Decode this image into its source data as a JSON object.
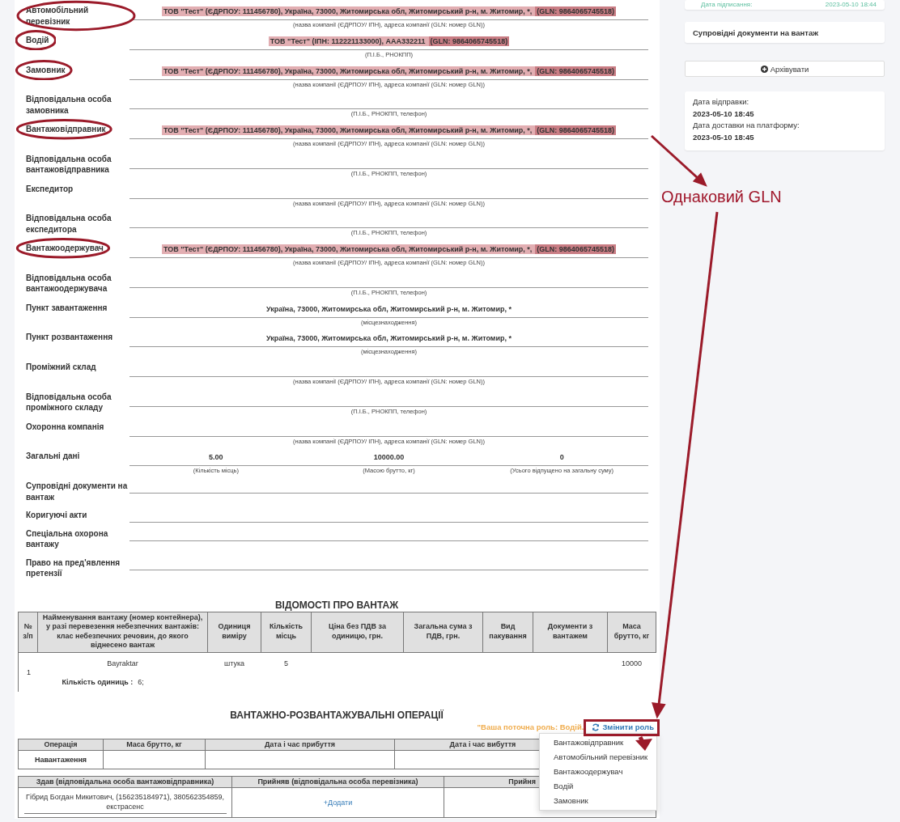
{
  "form": {
    "rows": [
      {
        "kind": "field",
        "label": "Автомобільний перевізник",
        "circled": true,
        "value": "ТОВ \"Тест\" (ЄДРПОУ: 111456780), Україна, 73000, Житомирська обл, Житомирський р-н, м. Житомир, *,",
        "gln": "(GLN: 9864065745518)",
        "highlighted": true,
        "hint": "(назва компанії (ЄДРПОУ/ ІПН), адреса компанії (GLN: номер GLN))"
      },
      {
        "kind": "field",
        "label": "Водій",
        "circled": true,
        "value": "ТОВ \"Тест\" (ІПН: 112221133000), ААА332211",
        "gln": "(GLN: 9864065745518)",
        "highlighted": true,
        "hint": "(П.І.Б., РНОКПП)"
      },
      {
        "kind": "field",
        "label": "Замовник",
        "circled": true,
        "value": "ТОВ \"Тест\" (ЄДРПОУ: 111456780), Україна, 73000, Житомирська обл, Житомирський р-н, м. Житомир, *,",
        "gln": "(GLN: 9864065745518)",
        "highlighted": true,
        "hint": "(назва компанії (ЄДРПОУ/ ІПН), адреса компанії (GLN: номер GLN))"
      },
      {
        "kind": "field",
        "label": "Відповідальна особа замовника",
        "circled": false,
        "hint": "(П.І.Б., РНОКПП, телефон)"
      },
      {
        "kind": "field",
        "label": "Вантажовідправник",
        "circled": true,
        "value": "ТОВ \"Тест\" (ЄДРПОУ: 111456780), Україна, 73000, Житомирська обл, Житомирський р-н, м. Житомир, *,",
        "gln": "(GLN: 9864065745518)",
        "highlighted": true,
        "hint": "(назва компанії (ЄДРПОУ/ ІПН), адреса компанії (GLN: номер GLN))"
      },
      {
        "kind": "field",
        "label": "Відповідальна особа вантажовідправника",
        "circled": false,
        "hint": "(П.І.Б., РНОКПП, телефон)"
      },
      {
        "kind": "field",
        "label": "Експедитор",
        "circled": false,
        "hint": "(назва компанії (ЄДРПОУ/ ІПН), адреса компанії (GLN: номер GLN))"
      },
      {
        "kind": "field",
        "label": "Відповідальна особа експедитора",
        "circled": false,
        "hint": "(П.І.Б., РНОКПП, телефон)"
      },
      {
        "kind": "field",
        "label": "Вантажоодержувач",
        "circled": true,
        "value": "ТОВ \"Тест\" (ЄДРПОУ: 111456780), Україна, 73000, Житомирська обл, Житомирський р-н, м. Житомир, *,",
        "gln": "(GLN: 9864065745518)",
        "highlighted": true,
        "hint": "(назва компанії (ЄДРПОУ/ ІПН), адреса компанії (GLN: номер GLN))"
      },
      {
        "kind": "field",
        "label": "Відповідальна особа вантажоодержувача",
        "circled": false,
        "hint": "(П.І.Б., РНОКПП, телефон)"
      },
      {
        "kind": "field",
        "label": "Пункт завантаження",
        "circled": false,
        "value": "Україна, 73000, Житомирська обл, Житомирський р-н, м. Житомир, *",
        "highlighted": false,
        "hint": "(місцезнаходження)"
      },
      {
        "kind": "field",
        "label": "Пункт розвантаження",
        "circled": false,
        "value": "Україна, 73000, Житомирська обл, Житомирський р-н, м. Житомир, *",
        "highlighted": false,
        "hint": "(місцезнаходження)"
      },
      {
        "kind": "field",
        "label": "Проміжний склад",
        "circled": false,
        "hint": "(назва компанії (ЄДРПОУ/ ІПН), адреса компанії (GLN: номер GLN))"
      },
      {
        "kind": "field",
        "label": "Відповідальна особа проміжного складу",
        "circled": false,
        "hint": "(П.І.Б., РНОКПП, телефон)"
      },
      {
        "kind": "field",
        "label": "Охоронна компанія",
        "circled": false,
        "hint": "(назва компанії (ЄДРПОУ/ ІПН), адреса компанії (GLN: номер GLN))"
      },
      {
        "kind": "totals",
        "label": "Загальні дані",
        "circled": false,
        "cells": [
          {
            "value": "5.00",
            "hint": "(Кількість місць)"
          },
          {
            "value": "10000.00",
            "hint": "(Масою брутто, кг)"
          },
          {
            "value": "0",
            "hint": "(Усього відпущено на загальну суму)"
          }
        ]
      },
      {
        "kind": "field",
        "label": "Супровідні документи на вантаж",
        "circled": false
      },
      {
        "kind": "field",
        "label": "Коригуючі акти",
        "circled": false
      },
      {
        "kind": "field",
        "label": "Спеціальна охорона вантажу",
        "circled": false
      },
      {
        "kind": "field",
        "label": "Право на пред'явлення претензії",
        "circled": false
      }
    ]
  },
  "cargo": {
    "title": "ВІДОМОСТІ ПРО ВАНТАЖ",
    "columns": [
      "№ з/п",
      "Найменування вантажу (номер контейнера), у разі перевезення небезпечних вантажів: клас небезпечних речовин, до якого віднесено вантаж",
      "Одиниця виміру",
      "Кількість місць",
      "Ціна без ПДВ за одиницю, грн.",
      "Загальна сума з ПДВ, грн.",
      "Вид пакування",
      "Документи з вантажем",
      "Маса брутто, кг"
    ],
    "rows": [
      {
        "number": "1",
        "name": "Bayraktar",
        "unit": "штука",
        "places": "5",
        "gross_mass": "10000",
        "units_label": "Кількість одиниць :",
        "units_value": "6;"
      }
    ]
  },
  "operations": {
    "title": "ВАНТАЖНО-РОЗВАНТАЖУВАЛЬНІ ОПЕРАЦІЇ",
    "role_note": "\"Ваша поточна роль: Водій.",
    "change_role_button": "Змінити роль",
    "role_menu": [
      "Вантажовідправник",
      "Автомобільний перевізник",
      "Вантажоодержувач",
      "Водій",
      "Замовник"
    ],
    "table": {
      "columns": [
        "Операція",
        "Маса брутто, кг",
        "Дата і час прибуття",
        "Дата і час вибуття"
      ],
      "rows": [
        {
          "operation": "Навантаження"
        }
      ]
    },
    "handover": {
      "columns": [
        "Здав (відповідальна особа вантажовідправника)",
        "Прийняв (відповідальна особа перевізника)",
        "Прийня"
      ],
      "handed_by": "Гібрид Богдан Микитович, (156235184971), 380562354859, екстрасенс",
      "add_link": "+Додати"
    }
  },
  "sidebar": {
    "signed_card": {
      "label": "Дата підписання:",
      "value": "2023-05-10 18:44"
    },
    "documents_card": "Супровідні документи на вантаж",
    "archive_button": "Архівувати",
    "dates": [
      {
        "label": "Дата відправки:",
        "value": "2023-05-10 18:45"
      },
      {
        "label": "Дата доставки на платформу:",
        "value": "2023-05-10 18:45"
      }
    ]
  },
  "annotation": {
    "label": "Однаковий GLN"
  }
}
